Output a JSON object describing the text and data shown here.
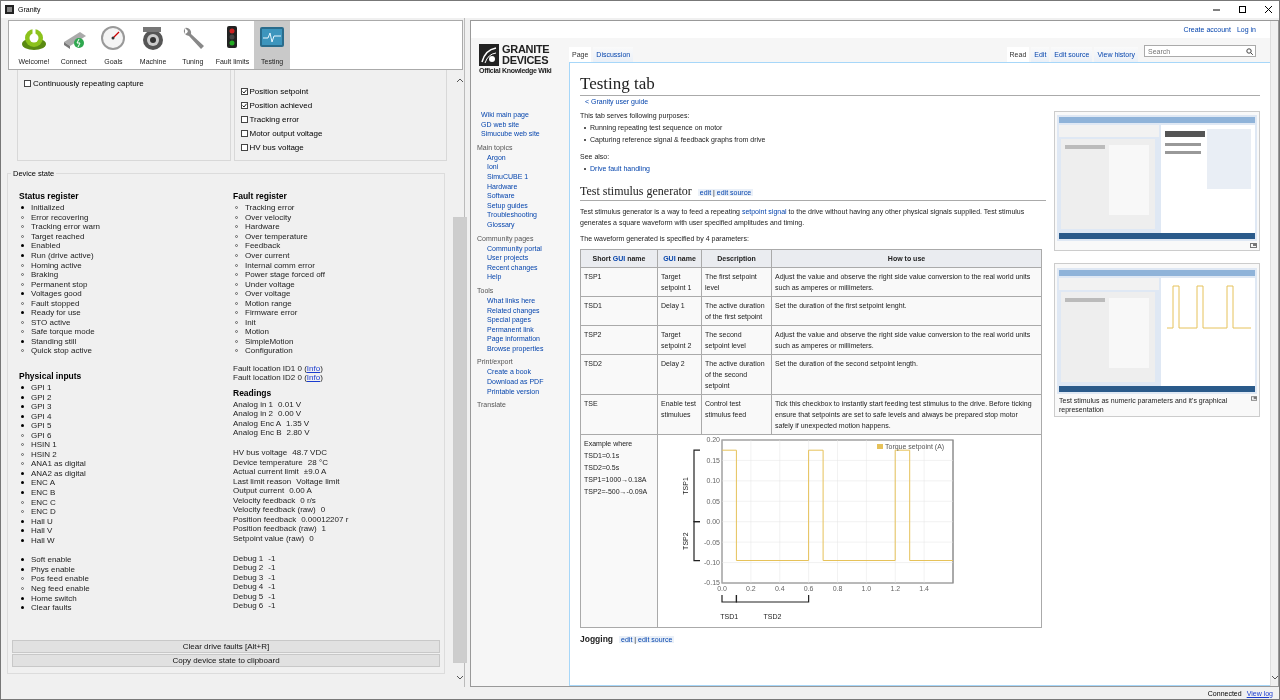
{
  "window": {
    "title": "Granity"
  },
  "toolbar": [
    {
      "label": "Welcome!",
      "kind": "power",
      "selected": false
    },
    {
      "label": "Connect",
      "kind": "plug",
      "selected": false
    },
    {
      "label": "Goals",
      "kind": "gauge",
      "selected": false
    },
    {
      "label": "Machine",
      "kind": "motor",
      "selected": false
    },
    {
      "label": "Tuning",
      "kind": "wrench",
      "selected": false
    },
    {
      "label": "Fault limits",
      "kind": "traffic",
      "selected": false
    },
    {
      "label": "Testing",
      "kind": "monitor",
      "selected": true
    }
  ],
  "capture": {
    "options": [
      {
        "label": "Continuously repeating capture",
        "checked": false
      }
    ],
    "signals": [
      {
        "label": "Position setpoint",
        "checked": true
      },
      {
        "label": "Position achieved",
        "checked": true
      },
      {
        "label": "Tracking error",
        "checked": false
      },
      {
        "label": "Motor output voltage",
        "checked": false
      },
      {
        "label": "HV bus voltage",
        "checked": false
      }
    ]
  },
  "device_state": {
    "title": "Device state",
    "status_register": {
      "heading": "Status register",
      "items": [
        {
          "label": "Initialized",
          "on": true
        },
        {
          "label": "Error recovering",
          "on": false
        },
        {
          "label": "Tracking error warn",
          "on": false
        },
        {
          "label": "Target reached",
          "on": false
        },
        {
          "label": "Enabled",
          "on": true
        },
        {
          "label": "Run (drive active)",
          "on": true
        },
        {
          "label": "Homing active",
          "on": false
        },
        {
          "label": "Braking",
          "on": false
        },
        {
          "label": "Permanent stop",
          "on": false
        },
        {
          "label": "Voltages good",
          "on": true
        },
        {
          "label": "Fault stopped",
          "on": false
        },
        {
          "label": "Ready for use",
          "on": true
        },
        {
          "label": "STO active",
          "on": false
        },
        {
          "label": "Safe torque mode",
          "on": false
        },
        {
          "label": "Standing still",
          "on": true
        },
        {
          "label": "Quick stop active",
          "on": false
        }
      ]
    },
    "physical_inputs": {
      "heading": "Physical inputs",
      "groups": [
        [
          {
            "label": "GPI 1",
            "on": true
          },
          {
            "label": "GPI 2",
            "on": true
          },
          {
            "label": "GPI 3",
            "on": true
          },
          {
            "label": "GPI 4",
            "on": true
          },
          {
            "label": "GPI 5",
            "on": true
          },
          {
            "label": "GPI 6",
            "on": false
          },
          {
            "label": "HSIN 1",
            "on": false
          },
          {
            "label": "HSIN 2",
            "on": false
          },
          {
            "label": "ANA1 as digital",
            "on": false
          },
          {
            "label": "ANA2 as digital",
            "on": true
          },
          {
            "label": "ENC A",
            "on": true
          },
          {
            "label": "ENC B",
            "on": true
          },
          {
            "label": "ENC C",
            "on": false
          },
          {
            "label": "ENC D",
            "on": false
          },
          {
            "label": "Hall U",
            "on": true
          },
          {
            "label": "Hall V",
            "on": true
          },
          {
            "label": "Hall W",
            "on": true
          }
        ],
        [
          {
            "label": "Soft enable",
            "on": true
          },
          {
            "label": "Phys enable",
            "on": true
          },
          {
            "label": "Pos feed enable",
            "on": false
          },
          {
            "label": "Neg feed enable",
            "on": false
          },
          {
            "label": "Home switch",
            "on": true
          },
          {
            "label": "Clear faults",
            "on": true
          }
        ]
      ]
    },
    "fault_register": {
      "heading": "Fault register",
      "items": [
        {
          "label": "Tracking error",
          "on": false
        },
        {
          "label": "Over velocity",
          "on": false
        },
        {
          "label": "Hardware",
          "on": false
        },
        {
          "label": "Over temperature",
          "on": false
        },
        {
          "label": "Feedback",
          "on": false
        },
        {
          "label": "Over current",
          "on": false
        },
        {
          "label": "Internal comm error",
          "on": false
        },
        {
          "label": "Power stage forced off",
          "on": false
        },
        {
          "label": "Under voltage",
          "on": false
        },
        {
          "label": "Over voltage",
          "on": false
        },
        {
          "label": "Motion range",
          "on": false
        },
        {
          "label": "Firmware error",
          "on": false
        },
        {
          "label": "Init",
          "on": false
        },
        {
          "label": "Motion",
          "on": false
        },
        {
          "label": "SimpleMotion",
          "on": false
        },
        {
          "label": "Configuration",
          "on": false
        }
      ]
    },
    "fault_locations": [
      {
        "before": "Fault location ID1 0 (",
        "link": "Info",
        "after": ")"
      },
      {
        "before": "Fault location ID2 0 (",
        "link": "Info",
        "after": ")"
      }
    ],
    "readings": {
      "heading": "Readings",
      "groups": [
        [
          {
            "label": "Analog in 1",
            "value": "0.01 V"
          },
          {
            "label": "Analog in 2",
            "value": "0.00 V"
          },
          {
            "label": "Analog Enc A",
            "value": "1.35 V"
          },
          {
            "label": "Analog Enc B",
            "value": "2.80 V"
          }
        ],
        [
          {
            "label": "HV bus voltage",
            "value": "48.7 VDC"
          },
          {
            "label": "Device temperature",
            "value": "28 °C"
          },
          {
            "label": "Actual current limit",
            "value": "±9.0 A"
          },
          {
            "label": "Last limit reason",
            "value": "Voltage limit"
          },
          {
            "label": "Output current",
            "value": "0.00 A"
          },
          {
            "label": "Velocity feedback",
            "value": "0 r/s"
          },
          {
            "label": "Velocity feedback (raw)",
            "value": "0"
          },
          {
            "label": "Position feedback",
            "value": "0.00012207 r"
          },
          {
            "label": "Position feedback (raw)",
            "value": "1"
          },
          {
            "label": "Setpoint value (raw)",
            "value": "0"
          }
        ],
        [
          {
            "label": "Debug 1",
            "value": "-1"
          },
          {
            "label": "Debug 2",
            "value": "-1"
          },
          {
            "label": "Debug 3",
            "value": "-1"
          },
          {
            "label": "Debug 4",
            "value": "-1"
          },
          {
            "label": "Debug 5",
            "value": "-1"
          },
          {
            "label": "Debug 6",
            "value": "-1"
          }
        ]
      ]
    },
    "buttons": [
      "Clear drive faults [Alt+R]",
      "Copy device state to clipboard"
    ]
  },
  "status_bar": {
    "status": "Connected",
    "link": "View log"
  },
  "wiki": {
    "user_links": [
      "Create account",
      "Log in"
    ],
    "logo": {
      "lines": [
        "GRANITE",
        "DEVICES"
      ],
      "tagline": "Official Knowledge Wiki"
    },
    "page_tabs": [
      {
        "label": "Page",
        "selected": true
      },
      {
        "label": "Discussion",
        "selected": false
      }
    ],
    "view_tabs": [
      {
        "label": "Read",
        "selected": true
      },
      {
        "label": "Edit",
        "selected": false
      },
      {
        "label": "Edit source",
        "selected": false
      },
      {
        "label": "View history",
        "selected": false
      }
    ],
    "search": {
      "placeholder": "Search"
    },
    "sidebar": [
      {
        "items": [
          "Wiki main page",
          "GD web site",
          "Simucube web site"
        ]
      },
      {
        "heading": "Main topics",
        "items": [
          "Argon",
          "Ioni",
          "SimuCUBE 1",
          "Hardware",
          "Software",
          "Setup guides",
          "Troubleshooting",
          "Glossary"
        ]
      },
      {
        "heading": "Community pages",
        "items": [
          "Community portal",
          "User projects",
          "Recent changes",
          "Help"
        ]
      },
      {
        "heading": "Tools",
        "items": [
          "What links here",
          "Related changes",
          "Special pages",
          "Permanent link",
          "Page information",
          "Browse properties"
        ]
      },
      {
        "heading": "Print/export",
        "items": [
          "Create a book",
          "Download as PDF",
          "Printable version"
        ]
      },
      {
        "heading": "Translate"
      }
    ],
    "title": "Testing tab",
    "breadcrumb": "< Granity user guide",
    "intro": "This tab serves following purposes:",
    "purposes": [
      "Running repeating test sequence on motor",
      "Capturing reference signal & feedback graphs from drive"
    ],
    "see_also_label": "See also:",
    "see_also": [
      "Drive fault handling"
    ],
    "figure_caption": "Test stimulus as numeric parameters and it's graphical representation",
    "section": {
      "heading": "Test stimulus generator",
      "edit_links": [
        "edit",
        "edit source"
      ],
      "separator": "|",
      "paragraphs": [
        [
          {
            "text": "Test stimulus generator is a way to feed a repeating "
          },
          {
            "link": "setpoint signal"
          },
          {
            "text": " to the drive without having any other physical signals supplied. Test stimulus generates a square waveform with user specified amplitudes and timing."
          }
        ],
        [
          {
            "text": "The waveform generated is specified by 4 parameters:"
          }
        ]
      ],
      "table": {
        "columns": [
          {
            "before": "Short ",
            "link": "GUI",
            "after": " name"
          },
          {
            "link": "GUI",
            "after": " name"
          },
          {
            "before": "Description"
          },
          {
            "before": "How to use"
          }
        ],
        "rows": [
          [
            "TSP1",
            "Target setpoint 1",
            "The first setpoint level",
            "Adjust the value and observe the right side value conversion to the real world units such as amperes or millimeters."
          ],
          [
            "TSD1",
            "Delay 1",
            "The active duration of the first setpoint",
            "Set the duration of the first setpoint lenght."
          ],
          [
            "TSP2",
            "Target setpoint 2",
            "The second setpoint level",
            "Adjust the value and observe the right side value conversion to the real world units such as amperes or millimeters."
          ],
          [
            "TSD2",
            "Delay 2",
            "The active duration of the second setpoint",
            "Set the duration of the second setpoint length."
          ],
          [
            "TSE",
            "Enable test stimulues",
            "Control test stimulus feed",
            "Tick this checkbox to instantly start feeding test stimulus to the drive. Before ticking ensure that setpoints are set to safe levels and always be prepared stop motor safely if unexpected motion happens."
          ]
        ],
        "example": {
          "lines": [
            "Example where",
            "TSD1=0.1s",
            "TSD2=0.5s",
            "TSP1=1000→0.18A",
            "TSP2=-500→-0.09A"
          ],
          "chart_data": {
            "type": "line",
            "x": [
              0,
              0.1,
              0.1,
              0.6,
              0.6,
              0.7,
              0.7,
              1.2,
              1.2,
              1.3,
              1.3,
              1.6
            ],
            "series": [
              {
                "name": "Torque setpoint (A)",
                "color": "#e6c25a",
                "values": [
                  0.175,
                  0.175,
                  -0.095,
                  -0.095,
                  0.175,
                  0.175,
                  -0.095,
                  -0.095,
                  0.175,
                  0.175,
                  -0.095,
                  -0.095
                ]
              }
            ],
            "xlim": [
              0,
              1.6
            ],
            "ylim": [
              -0.15,
              0.2
            ],
            "grid": true,
            "xticks": [
              {
                "value": 0,
                "label": "0.0"
              },
              {
                "value": 0.2,
                "label": "0.2"
              },
              {
                "value": 0.4,
                "label": "0.4"
              },
              {
                "value": 0.6,
                "label": "0.6"
              },
              {
                "value": 0.8,
                "label": "0.8"
              },
              {
                "value": 1,
                "label": "1.0"
              },
              {
                "value": 1.2,
                "label": "1.2"
              },
              {
                "value": 1.4,
                "label": "1.4"
              }
            ],
            "yticks": [
              {
                "value": 0.2,
                "label": "0.20"
              },
              {
                "value": 0.15,
                "label": "0.15"
              },
              {
                "value": 0.1,
                "label": "0.10"
              },
              {
                "value": 0.05,
                "label": "0.05"
              },
              {
                "value": 0,
                "label": "0.00"
              },
              {
                "value": -0.05,
                "label": "-0.05"
              },
              {
                "value": -0.1,
                "label": "-0.10"
              },
              {
                "value": -0.15,
                "label": "-0.15"
              }
            ],
            "annotations": [
              "TSP1",
              "TSP2",
              "TSD1",
              "TSD2"
            ]
          }
        }
      }
    },
    "next_section": {
      "heading": "Jogging",
      "edit_links": [
        "edit",
        "edit source"
      ],
      "separator": "|"
    }
  }
}
